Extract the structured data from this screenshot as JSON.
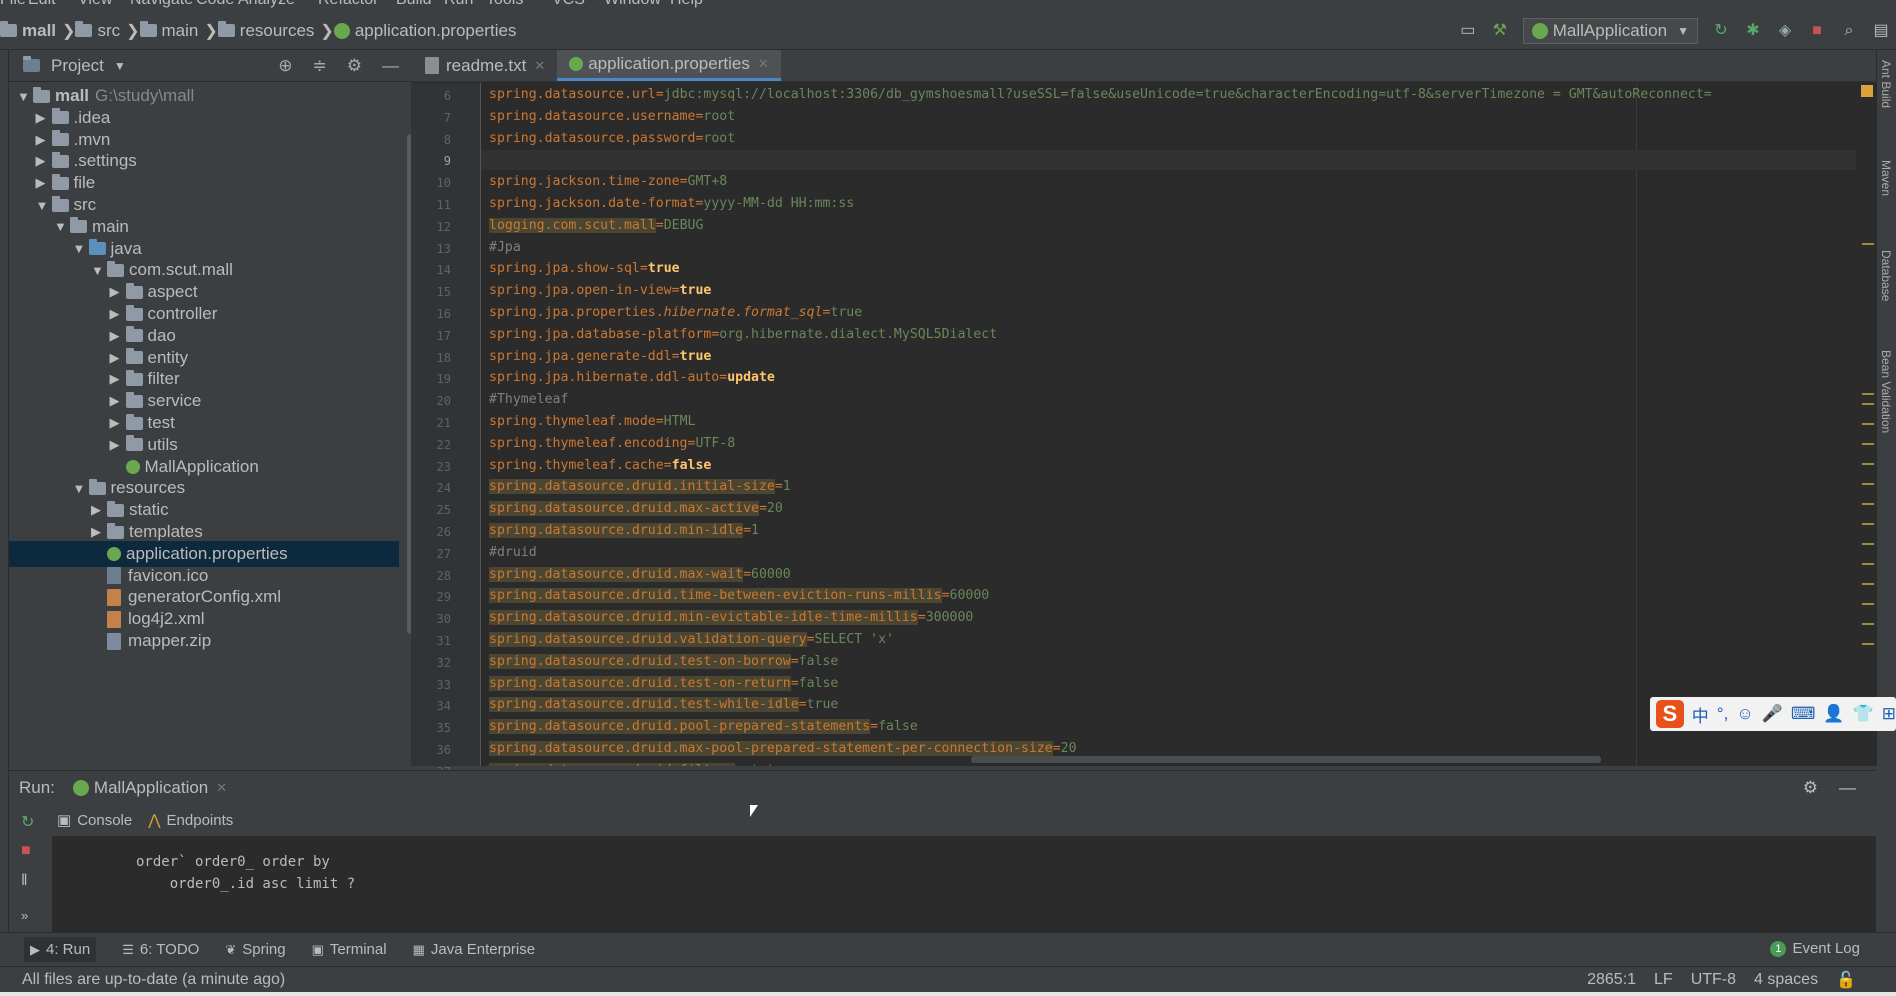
{
  "menu": [
    "File",
    "Edit",
    "View",
    "Navigate",
    "Code",
    "Analyze",
    "Refactor",
    "Build",
    "Run",
    "Tools",
    "VCS",
    "Window",
    "Help"
  ],
  "breadcrumb": [
    "mall",
    "src",
    "main",
    "resources",
    "application.properties"
  ],
  "run_config": "MallApplication",
  "project_panel": {
    "title": "Project"
  },
  "tree": [
    {
      "label": "mall",
      "extra": "G:\\study\\mall",
      "depth": 0,
      "open": true,
      "kind": "folder"
    },
    {
      "label": ".idea",
      "depth": 1,
      "open": false,
      "kind": "folder"
    },
    {
      "label": ".mvn",
      "depth": 1,
      "open": false,
      "kind": "folder"
    },
    {
      "label": ".settings",
      "depth": 1,
      "open": false,
      "kind": "folder"
    },
    {
      "label": "file",
      "depth": 1,
      "open": false,
      "kind": "folder"
    },
    {
      "label": "src",
      "depth": 1,
      "open": true,
      "kind": "folder"
    },
    {
      "label": "main",
      "depth": 2,
      "open": true,
      "kind": "folder"
    },
    {
      "label": "java",
      "depth": 3,
      "open": true,
      "kind": "folder-blue"
    },
    {
      "label": "com.scut.mall",
      "depth": 4,
      "open": true,
      "kind": "folder"
    },
    {
      "label": "aspect",
      "depth": 5,
      "open": false,
      "kind": "folder"
    },
    {
      "label": "controller",
      "depth": 5,
      "open": false,
      "kind": "folder"
    },
    {
      "label": "dao",
      "depth": 5,
      "open": false,
      "kind": "folder"
    },
    {
      "label": "entity",
      "depth": 5,
      "open": false,
      "kind": "folder"
    },
    {
      "label": "filter",
      "depth": 5,
      "open": false,
      "kind": "folder"
    },
    {
      "label": "service",
      "depth": 5,
      "open": false,
      "kind": "folder"
    },
    {
      "label": "test",
      "depth": 5,
      "open": false,
      "kind": "folder"
    },
    {
      "label": "utils",
      "depth": 5,
      "open": false,
      "kind": "folder"
    },
    {
      "label": "MallApplication",
      "depth": 5,
      "kind": "spring"
    },
    {
      "label": "resources",
      "depth": 3,
      "open": true,
      "kind": "folder"
    },
    {
      "label": "static",
      "depth": 4,
      "open": false,
      "kind": "folder"
    },
    {
      "label": "templates",
      "depth": 4,
      "open": false,
      "kind": "folder"
    },
    {
      "label": "application.properties",
      "depth": 4,
      "kind": "props",
      "selected": true
    },
    {
      "label": "favicon.ico",
      "depth": 4,
      "kind": "ico"
    },
    {
      "label": "generatorConfig.xml",
      "depth": 4,
      "kind": "xml"
    },
    {
      "label": "log4j2.xml",
      "depth": 4,
      "kind": "xml"
    },
    {
      "label": "mapper.zip",
      "depth": 4,
      "kind": "zip"
    }
  ],
  "tabs": [
    {
      "label": "readme.txt",
      "active": false
    },
    {
      "label": "application.properties",
      "active": true
    }
  ],
  "code": [
    {
      "n": "6",
      "k": "spring.datasource.url",
      "v": "jdbc:mysql://localhost:3306/db_gymshoesmall?useSSL=false&useUnicode=true&characterEncoding=utf-8&serverTimezone = GMT&autoReconnect="
    },
    {
      "n": "7",
      "k": "spring.datasource.username",
      "v": "root"
    },
    {
      "n": "8",
      "k": "spring.datasource.password",
      "v": "root"
    },
    {
      "n": "9",
      "k": "",
      "v": "",
      "current": true
    },
    {
      "n": "10",
      "k": "spring.jackson.time-zone",
      "v": "GMT+8"
    },
    {
      "n": "11",
      "k": "spring.jackson.date-format",
      "v": "yyyy-MM-dd HH:mm:ss"
    },
    {
      "n": "12",
      "k": "logging.com.scut.mall",
      "v": "DEBUG",
      "hi": true
    },
    {
      "n": "13",
      "comment": "#Jpa"
    },
    {
      "n": "14",
      "k": "spring.jpa.show-sql",
      "v": "true",
      "bold": true
    },
    {
      "n": "15",
      "k": "spring.jpa.open-in-view",
      "v": "true",
      "bold": true
    },
    {
      "n": "16",
      "k": "spring.jpa.properties.",
      "ki": "hibernate.format_sql",
      "v": "true"
    },
    {
      "n": "17",
      "k": "spring.jpa.database-platform",
      "v": "org.hibernate.dialect.MySQL5Dialect"
    },
    {
      "n": "18",
      "k": "spring.jpa.generate-ddl",
      "v": "true",
      "bold": true
    },
    {
      "n": "19",
      "k": "spring.jpa.hibernate.ddl-auto",
      "v": "update",
      "bold": true
    },
    {
      "n": "20",
      "comment": "#Thymeleaf"
    },
    {
      "n": "21",
      "k": "spring.thymeleaf.mode",
      "v": "HTML"
    },
    {
      "n": "22",
      "k": "spring.thymeleaf.encoding",
      "v": "UTF-8"
    },
    {
      "n": "23",
      "k": "spring.thymeleaf.cache",
      "v": "false",
      "bold": true
    },
    {
      "n": "24",
      "k": "spring.datasource.druid.initial-size",
      "v": "1",
      "hi": true
    },
    {
      "n": "25",
      "k": "spring.datasource.druid.max-active",
      "v": "20",
      "hi": true
    },
    {
      "n": "26",
      "k": "spring.datasource.druid.min-idle",
      "v": "1",
      "hi": true
    },
    {
      "n": "27",
      "comment": "#druid"
    },
    {
      "n": "28",
      "k": "spring.datasource.druid.max-wait",
      "v": "60000",
      "hi": true
    },
    {
      "n": "29",
      "k": "spring.datasource.druid.time-between-eviction-runs-millis",
      "v": "60000",
      "hi": true
    },
    {
      "n": "30",
      "k": "spring.datasource.druid.min-evictable-idle-time-millis",
      "v": "300000",
      "hi": true
    },
    {
      "n": "31",
      "k": "spring.datasource.druid.validation-query",
      "v": "SELECT 'x'",
      "hi": true
    },
    {
      "n": "32",
      "k": "spring.datasource.druid.test-on-borrow",
      "v": "false",
      "hi": true
    },
    {
      "n": "33",
      "k": "spring.datasource.druid.test-on-return",
      "v": "false",
      "hi": true
    },
    {
      "n": "34",
      "k": "spring.datasource.druid.test-while-idle",
      "v": "true",
      "hi": true
    },
    {
      "n": "35",
      "k": "spring.datasource.druid.pool-prepared-statements",
      "v": "false",
      "hi": true
    },
    {
      "n": "36",
      "k": "spring.datasource.druid.max-pool-prepared-statement-per-connection-size",
      "v": "20",
      "hi": true
    },
    {
      "n": "37",
      "k": "spring.datasource.druid.filters",
      "v": "stat",
      "hi": true
    }
  ],
  "right_tools": [
    "Ant Build",
    "Maven",
    "Database",
    "Bean Validation"
  ],
  "run_panel": {
    "label": "Run:",
    "config": "MallApplication",
    "sub_tabs": [
      "Console",
      "Endpoints"
    ]
  },
  "console_lines": [
    "order` order0_ order by",
    "    order0_.id asc limit ?"
  ],
  "bottom_tabs": [
    "4: Run",
    "6: TODO",
    "Spring",
    "Terminal",
    "Java Enterprise"
  ],
  "event_log": {
    "count": "1",
    "label": "Event Log"
  },
  "status": {
    "message": "All files are up-to-date (a minute ago)",
    "position": "2865:1",
    "line_sep": "LF",
    "encoding": "UTF-8",
    "indent": "4 spaces"
  },
  "ime": {
    "logo": "S",
    "chars": [
      "中",
      "°,",
      "☺",
      "🎤",
      "⌨",
      "👤",
      "👕",
      "⊞"
    ]
  }
}
